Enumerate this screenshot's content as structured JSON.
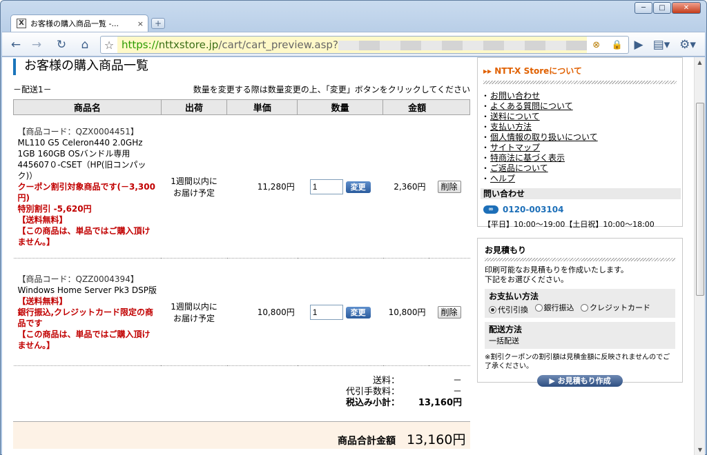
{
  "window": {
    "min": "─",
    "max": "□",
    "close": "✕"
  },
  "tab": {
    "title": "お客様の購入商品一覧 -...",
    "favicon": "X",
    "close": "×",
    "new": "+"
  },
  "toolbar": {
    "back": "←",
    "forward": "→",
    "reload": "↻",
    "home": "⌂",
    "star": "☆",
    "url_scheme": "https://",
    "url_host": "nttxstore.jp",
    "url_path": "/cart/cart_preview.asp?",
    "go": "▶",
    "page": "▤▾",
    "wrench": "⚙▾"
  },
  "page": {
    "title": "お客様の購入商品一覧",
    "delivery": "－配送1－",
    "instruction": "数量を変更する際は数量変更の上、「変更」ボタンをクリックしてください",
    "headers": [
      "商品名",
      "出荷",
      "単価",
      "数量",
      "金額"
    ],
    "items": [
      {
        "code": "【商品コード：QZX0004451】",
        "name": "ML110 G5 Celeron440 2.0GHz 1GB 160GB OSバンドル専用 445607０-CSET（HP(旧コンパック)）",
        "notes": [
          "クーポン割引対象商品です(－3,300円)",
          "特別割引 -5,620円",
          "【送料無料】",
          "【この商品は、単品ではご購入頂けません。】"
        ],
        "ship": "1週間以内に\nお届け予定",
        "price": "11,280円",
        "qty": "1",
        "change": "変更",
        "amount": "2,360円",
        "delete": "削除"
      },
      {
        "code": "【商品コード：QZZ0004394】",
        "name": "Windows Home Server Pk3 DSP版",
        "notes": [
          "【送料無料】",
          "銀行振込,クレジットカード限定の商品です",
          "【この商品は、単品ではご購入頂けません。】"
        ],
        "ship": "1週間以内に\nお届け予定",
        "price": "10,800円",
        "qty": "1",
        "change": "変更",
        "amount": "10,800円",
        "delete": "削除"
      }
    ],
    "summary": [
      {
        "label": "送料：",
        "value": "－"
      },
      {
        "label": "代引手数料：",
        "value": "－"
      },
      {
        "label": "税込み小計：",
        "value": "13,160円"
      }
    ],
    "total_label": "商品合計金額",
    "total_value": "13,160円"
  },
  "sidebar": {
    "about_title": "NTT-X Storeについて",
    "about_arrow": "▸▸",
    "links": [
      "お問い合わせ",
      "よくある質問について",
      "送料について",
      "支払い方法",
      "個人情報の取り扱いについて",
      "サイトマップ",
      "特商法に基づく表示",
      "ご返品について",
      "ヘルプ"
    ],
    "contact_title": "問い合わせ",
    "phone": "0120-003104",
    "freedial": "∞",
    "hours": "【平日】10:00～19:00【土日祝】10:00～18:00",
    "estimate_title": "お見積もり",
    "estimate_desc1": "印刷可能なお見積もりを作成いたします。",
    "estimate_desc2": "下記をお選びください。",
    "payment_title": "お支払い方法",
    "payment_options": [
      "代引引換",
      "銀行振込",
      "クレジットカード"
    ],
    "shipping_title": "配送方法",
    "shipping_value": "一括配送",
    "note": "※割引クーポンの割引額は見積金額に反映されませんのでご了承ください。",
    "estimate_button": "お見積もり作成",
    "estimate_btn_icon": "▶"
  }
}
